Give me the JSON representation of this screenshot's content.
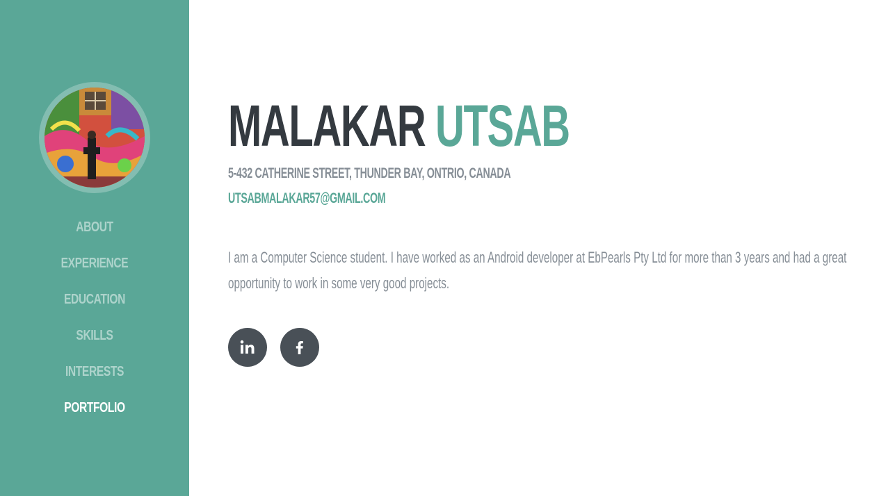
{
  "profile": {
    "first_name": "MALAKAR",
    "last_name": "UTSAB",
    "address": "5-432 CATHERINE STREET, THUNDER BAY, ONTRIO, CANADA",
    "email": "UTSABMALAKAR57@GMAIL.COM",
    "bio": "I am a Computer Science student. I have worked as an Android developer at EbPearls Pty Ltd for more than 3 years and had a great opportunity to work in some very good projects."
  },
  "nav": {
    "items": [
      {
        "label": "About"
      },
      {
        "label": "Experience"
      },
      {
        "label": "Education"
      },
      {
        "label": "Skills"
      },
      {
        "label": "Interests"
      },
      {
        "label": "Portfolio",
        "active": true
      }
    ]
  },
  "social": [
    {
      "icon": "linkedin-icon"
    },
    {
      "icon": "facebook-icon"
    }
  ],
  "colors": {
    "primary": "#5aa797",
    "heading": "#343a40",
    "muted": "#868e96",
    "social_bg": "#495057"
  }
}
